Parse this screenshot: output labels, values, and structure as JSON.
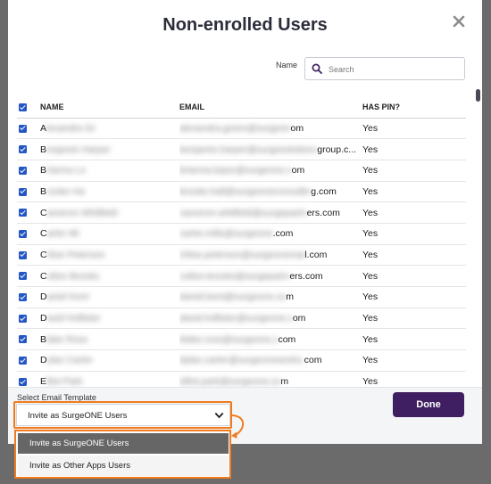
{
  "dialog": {
    "title": "Non-enrolled Users"
  },
  "search": {
    "label": "Name",
    "placeholder": "Search",
    "value": ""
  },
  "table": {
    "headers": [
      "NAME",
      "EMAIL",
      "HAS PIN?"
    ],
    "rows": [
      {
        "name_visible": "A",
        "name_hidden": "lexandra Gr",
        "email_hidden": "alexandra.green@surgeon",
        "email_visible": "om",
        "has_pin": "Yes"
      },
      {
        "name_visible": "B",
        "name_hidden": "enjamin Harper",
        "email_hidden": "benjamin.harper@surgesolutions",
        "email_visible": "group.c...",
        "has_pin": "Yes"
      },
      {
        "name_visible": "B",
        "name_hidden": "rianna Lo",
        "email_hidden": "brianna.lopez@surgeone.c",
        "email_visible": "om",
        "has_pin": "Yes"
      },
      {
        "name_visible": "B",
        "name_hidden": "rooke Ha",
        "email_hidden": "brooke.hall@surgeoneconsultin",
        "email_visible": "g.com",
        "has_pin": "Yes"
      },
      {
        "name_visible": "C",
        "name_hidden": "ameron Whitfield",
        "email_hidden": "cameron.whitfield@surgepartn",
        "email_visible": "ers.com",
        "has_pin": "Yes"
      },
      {
        "name_visible": "C",
        "name_hidden": "arter Mi",
        "email_hidden": "carter.mills@surgeone",
        "email_visible": ".com",
        "has_pin": "Yes"
      },
      {
        "name_visible": "C",
        "name_hidden": "hloe Peterson",
        "email_hidden": "chloe.peterson@surgeonemai",
        "email_visible": "l.com",
        "has_pin": "Yes"
      },
      {
        "name_visible": "C",
        "name_hidden": "olton Brooks",
        "email_hidden": "colton.brooks@surgepartn",
        "email_visible": "ers.com",
        "has_pin": "Yes"
      },
      {
        "name_visible": "D",
        "name_hidden": "aniel Kent",
        "email_hidden": "daniel.kent@surgeone.co",
        "email_visible": "m",
        "has_pin": "Yes"
      },
      {
        "name_visible": "D",
        "name_hidden": "avid Hollister",
        "email_hidden": "david.hollister@surgeone.c",
        "email_visible": "om",
        "has_pin": "Yes"
      },
      {
        "name_visible": "B",
        "name_hidden": "lake Ross",
        "email_hidden": "blake.ross@surgeone.c",
        "email_visible": "com",
        "has_pin": "Yes"
      },
      {
        "name_visible": "D",
        "name_hidden": "ylan Carter",
        "email_hidden": "dylan.carter@surgeoneworks.",
        "email_visible": "com",
        "has_pin": "Yes"
      },
      {
        "name_visible": "E",
        "name_hidden": "lliot Park",
        "email_hidden": "elliot.park@surgeone.co",
        "email_visible": "m",
        "has_pin": "Yes"
      }
    ]
  },
  "footer": {
    "template_label": "Select Email Template",
    "template_selected": "Invite as SurgeONE Users",
    "done_label": "Done"
  },
  "dropdown": {
    "options": [
      "Invite as SurgeONE Users",
      "Invite as Other Apps Users"
    ]
  },
  "colors": {
    "accent": "#3f1f61",
    "highlight": "#f07b1f",
    "checkbox": "#2457c5"
  }
}
